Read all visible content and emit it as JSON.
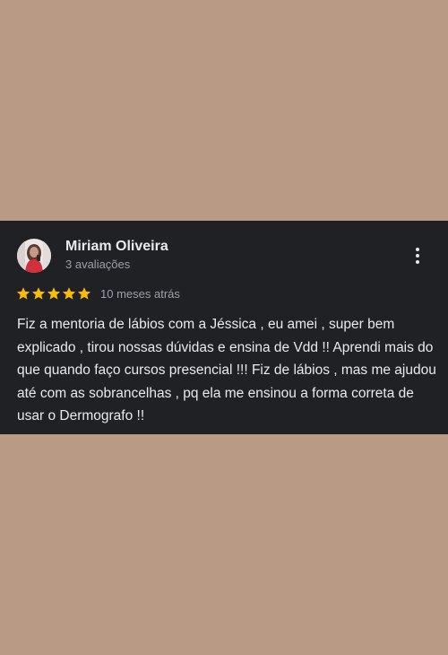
{
  "review": {
    "reviewer_name": "Miriam Oliveira",
    "reviewer_meta": "3 avaliações",
    "rating": 5,
    "rating_max": 5,
    "date": "10 meses atrás",
    "text": "Fiz a mentoria de lábios com a Jéssica , eu amei , super bem explicado , tirou nossas dúvidas e ensina de Vdd !! Aprendi mais do que quando faço cursos presencial !!! Fiz de lábios , mas me ajudou até com as sobrancelhas , pq ela me ensinou a forma correta de usar o Dermografo !!"
  },
  "icons": {
    "star": "star-icon",
    "more": "more-vert-icon",
    "avatar": "avatar"
  },
  "colors": {
    "page_background": "#b99a84",
    "card_background": "#202124",
    "star": "#fbbc04",
    "primary_text": "#e8eaed",
    "secondary_text": "#9aa0a6"
  }
}
